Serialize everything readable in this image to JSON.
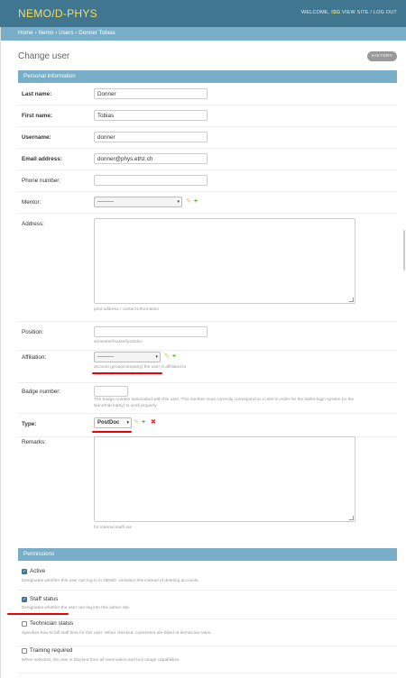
{
  "header": {
    "brand": "NEMO/D-PHYS",
    "welcome": "WELCOME,",
    "user": "ISG",
    "view_site": "VIEW SITE",
    "sep": "/",
    "logout": "LOG OUT"
  },
  "breadcrumbs": {
    "home": "Home",
    "nemo": "Nemo",
    "users": "Users",
    "current": "Donner Tobias",
    "sep": "›"
  },
  "page": {
    "title": "Change user",
    "history": "HISTORY"
  },
  "personal": {
    "heading": "Personal information",
    "last_name_label": "Last name:",
    "last_name": "Donner",
    "first_name_label": "First name:",
    "first_name": "Tobias",
    "username_label": "Username:",
    "username": "donner",
    "email_label": "Email address:",
    "email": "donner@phys.ethz.ch",
    "phone_label": "Phone number:",
    "phone": "",
    "mentor_label": "Mentor:",
    "mentor_value": "---------",
    "address_label": "Address:",
    "address_help": "post address / contact information",
    "position_label": "Position:",
    "position_help": "semester/master/postdoc",
    "affiliation_label": "Affiliation:",
    "affiliation_value": "---------",
    "affiliation_help": "account (group/company) the user is affiliated to",
    "badge_label": "Badge number:",
    "badge_help_1": "The badge number associated with this user. This number must correctly correspond to a user in order for the tablet-login system (in the",
    "badge_help_2": "NanoFab lobby) to work properly.",
    "type_label": "Type:",
    "type_value": "PostDoc",
    "remarks_label": "Remarks:",
    "remarks_help": "for internal staff use"
  },
  "permissions": {
    "heading": "Permissions",
    "active_label": "Active",
    "active_help": "Designates whether this user can log in to NEMO. Unselect this instead of deleting accounts.",
    "staff_label": "Staff status",
    "staff_help": "Designates whether the user can log into this admin site.",
    "tech_label": "Technician status",
    "tech_help": "Specifies how to bill staff time for this user. When checked, customers are billed at technician rates.",
    "training_label": "Training required",
    "training_help": "When selected, the user is blocked from all reservation and tool usage capabilities."
  },
  "icons": {
    "pencil": "pencil-icon",
    "plus": "plus-icon",
    "delete": "delete-icon",
    "dropdown": "chevron-down-icon"
  },
  "colors": {
    "header": "#417690",
    "brand": "#f5dd5d",
    "breadcrumbs": "#79aec8",
    "panel_head": "#79aec8",
    "annotation": "#e00000"
  }
}
